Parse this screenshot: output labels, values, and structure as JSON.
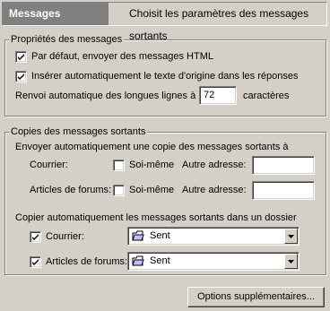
{
  "header": {
    "title": "Messages",
    "description": "Choisit les paramètres des messages sortants"
  },
  "properties": {
    "legend": "Propriétés des messages",
    "html_default": {
      "label": "Par défaut, envoyer des messages HTML",
      "checked": true
    },
    "insert_original": {
      "label": "Insérer automatiquement le texte d'origine dans les réponses",
      "checked": true
    },
    "wrap_label": "Renvoi automatique des longues lignes à",
    "wrap_value": "72",
    "wrap_unit": "caractères"
  },
  "copies": {
    "legend": "Copies des messages sortants",
    "auto_copy_label": "Envoyer automatiquement une copie des messages sortants à",
    "mail_label": "Courrier:",
    "forums_label": "Articles de forums:",
    "self_label": "Soi-même",
    "other_address_label": "Autre adresse:",
    "mail_self_checked": false,
    "forums_self_checked": false,
    "mail_other_address": "",
    "forums_other_address": "",
    "folder_copy_label": "Copier automatiquement les messages sortants dans un dossier",
    "folder_mail_label": "Courrier:",
    "folder_mail_checked": true,
    "folder_mail_value": "Sent",
    "folder_forums_label": "Articles de forums:",
    "folder_forums_checked": true,
    "folder_forums_value": "Sent"
  },
  "footer": {
    "more_options_label": "Options supplémentaires..."
  }
}
